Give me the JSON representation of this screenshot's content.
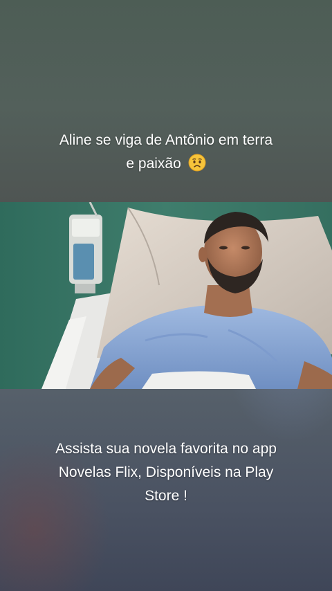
{
  "top_caption": {
    "line1": "Aline se viga de Antônio em terra",
    "line2": "e paixão"
  },
  "emoji_icon": "worried-face-icon",
  "bottom_caption": {
    "line1": "Assista sua novela favorita no app",
    "line2": "Novelas Flix, Disponíveis na Play",
    "line3": "Store !"
  },
  "colors": {
    "caption_text": "#ffffff",
    "hospital_wall": "#3f7a69",
    "gown": "#8aa9d6",
    "pillow": "#d8d0c8"
  }
}
